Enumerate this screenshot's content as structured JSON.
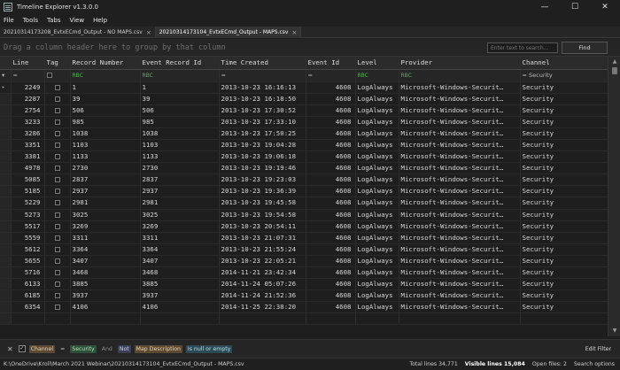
{
  "window": {
    "title": "Timeline Explorer v1.3.0.0",
    "min": "—",
    "max": "☐",
    "close": "✕"
  },
  "menu": [
    "File",
    "Tools",
    "Tabs",
    "View",
    "Help"
  ],
  "tabs": [
    {
      "label": "20210314173208_EvtxECmd_Output - NO MAPS.csv",
      "active": false
    },
    {
      "label": "20210314173104_EvtxECmd_Output - MAPS.csv",
      "active": true
    }
  ],
  "groupbar": {
    "hint": "Drag a column header here to group by that column",
    "search_placeholder": "Enter text to search...",
    "find_label": "Find"
  },
  "grid": {
    "columns": [
      "Line",
      "Tag",
      "Record Number",
      "Event Record Id",
      "Time Created",
      "Event Id",
      "Level",
      "Provider",
      "Channel"
    ],
    "filter_row": {
      "line": "=",
      "tag": "",
      "record_number": "RBC",
      "event_record_id": "RBC",
      "time_created": "=",
      "event_id": "=",
      "level": "RBC",
      "provider": "RBC",
      "channel": "= Security"
    },
    "rows": [
      [
        "2249",
        "1",
        "1",
        "2013-10-23 16:16:13",
        "4608",
        "LogAlways",
        "Microsoft-Windows-Securit…",
        "Security"
      ],
      [
        "2287",
        "39",
        "39",
        "2013-10-23 16:18:50",
        "4608",
        "LogAlways",
        "Microsoft-Windows-Securit…",
        "Security"
      ],
      [
        "2754",
        "506",
        "506",
        "2013-10-23 17:30:52",
        "4608",
        "LogAlways",
        "Microsoft-Windows-Securit…",
        "Security"
      ],
      [
        "3233",
        "985",
        "985",
        "2013-10-23 17:33:10",
        "4608",
        "LogAlways",
        "Microsoft-Windows-Securit…",
        "Security"
      ],
      [
        "3286",
        "1038",
        "1038",
        "2013-10-23 17:50:25",
        "4608",
        "LogAlways",
        "Microsoft-Windows-Securit…",
        "Security"
      ],
      [
        "3351",
        "1103",
        "1103",
        "2013-10-23 19:04:28",
        "4608",
        "LogAlways",
        "Microsoft-Windows-Securit…",
        "Security"
      ],
      [
        "3381",
        "1133",
        "1133",
        "2013-10-23 19:06:18",
        "4608",
        "LogAlways",
        "Microsoft-Windows-Securit…",
        "Security"
      ],
      [
        "4978",
        "2730",
        "2730",
        "2013-10-23 19:19:46",
        "4608",
        "LogAlways",
        "Microsoft-Windows-Securit…",
        "Security"
      ],
      [
        "5085",
        "2837",
        "2837",
        "2013-10-23 19:23:03",
        "4608",
        "LogAlways",
        "Microsoft-Windows-Securit…",
        "Security"
      ],
      [
        "5185",
        "2937",
        "2937",
        "2013-10-23 19:36:39",
        "4608",
        "LogAlways",
        "Microsoft-Windows-Securit…",
        "Security"
      ],
      [
        "5229",
        "2981",
        "2981",
        "2013-10-23 19:45:58",
        "4608",
        "LogAlways",
        "Microsoft-Windows-Securit…",
        "Security"
      ],
      [
        "5273",
        "3025",
        "3025",
        "2013-10-23 19:54:58",
        "4608",
        "LogAlways",
        "Microsoft-Windows-Securit…",
        "Security"
      ],
      [
        "5517",
        "3269",
        "3269",
        "2013-10-23 20:54:11",
        "4608",
        "LogAlways",
        "Microsoft-Windows-Securit…",
        "Security"
      ],
      [
        "5559",
        "3311",
        "3311",
        "2013-10-23 21:07:31",
        "4608",
        "LogAlways",
        "Microsoft-Windows-Securit…",
        "Security"
      ],
      [
        "5612",
        "3364",
        "3364",
        "2013-10-23 21:55:24",
        "4608",
        "LogAlways",
        "Microsoft-Windows-Securit…",
        "Security"
      ],
      [
        "5655",
        "3407",
        "3407",
        "2013-10-23 22:05:21",
        "4608",
        "LogAlways",
        "Microsoft-Windows-Securit…",
        "Security"
      ],
      [
        "5716",
        "3468",
        "3468",
        "2014-11-21 23:42:34",
        "4608",
        "LogAlways",
        "Microsoft-Windows-Securit…",
        "Security"
      ],
      [
        "6133",
        "3885",
        "3885",
        "2014-11-24 05:07:26",
        "4608",
        "LogAlways",
        "Microsoft-Windows-Securit…",
        "Security"
      ],
      [
        "6185",
        "3937",
        "3937",
        "2014-11-24 21:52:36",
        "4608",
        "LogAlways",
        "Microsoft-Windows-Securit…",
        "Security"
      ],
      [
        "6354",
        "4106",
        "4106",
        "2014-11-25 22:38:20",
        "4608",
        "LogAlways",
        "Microsoft-Windows-Securit…",
        "Security"
      ],
      [
        "",
        "",
        "",
        "",
        "",
        "",
        "",
        ""
      ]
    ]
  },
  "filterbar": {
    "tokens": [
      {
        "text": "Channel",
        "kind": "field"
      },
      {
        "text": "=",
        "kind": "op"
      },
      {
        "text": "Security",
        "kind": "val"
      },
      {
        "text": "And",
        "kind": "and"
      },
      {
        "text": "Not",
        "kind": "not"
      },
      {
        "text": "Map Description",
        "kind": "field2"
      },
      {
        "text": "Is null or empty",
        "kind": "cond"
      }
    ],
    "edit_filter": "Edit Filter"
  },
  "status": {
    "path": "K:\\OneDrive\\Kroll\\March 2021 Webinar\\20210314173104_EvtxECmd_Output - MAPS.csv",
    "total_lines": "Total lines 34,771",
    "visible_lines": "Visible lines 15,084",
    "open_files": "Open files: 2",
    "search_options": "Search options"
  }
}
